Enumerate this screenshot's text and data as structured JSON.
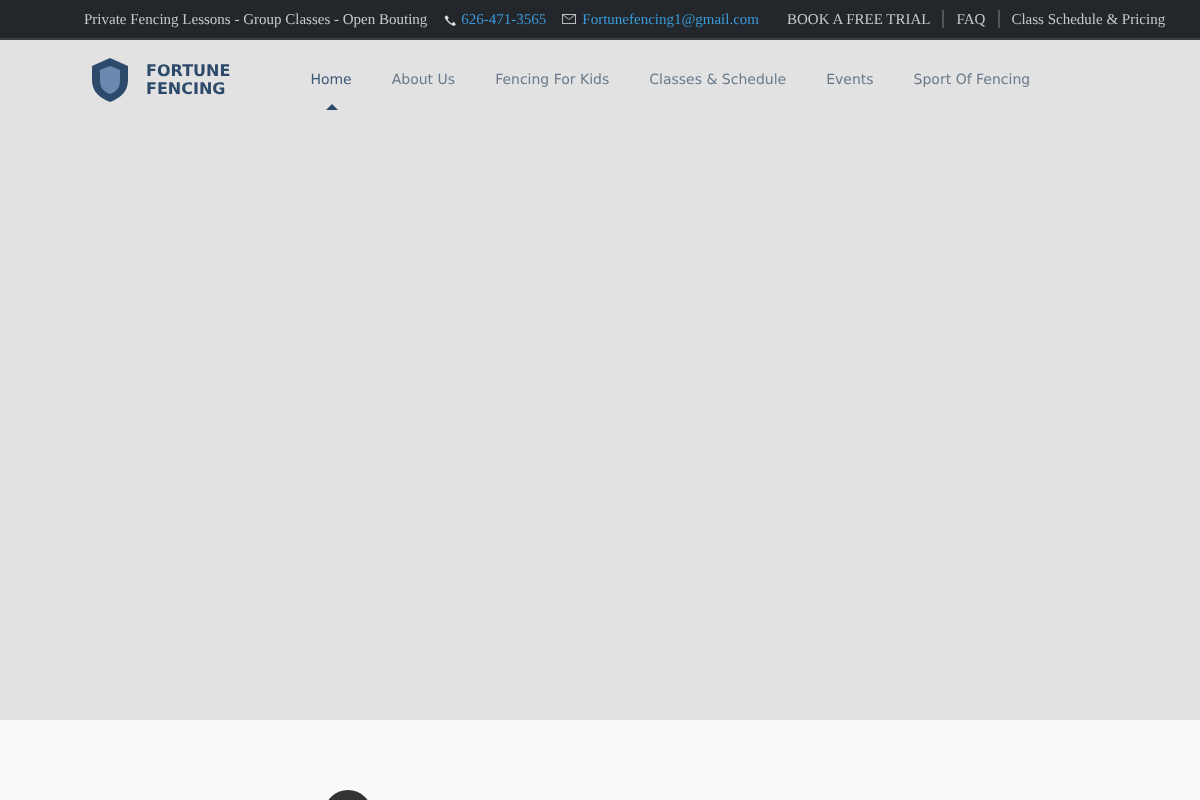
{
  "top_bar": {
    "tagline": "Private Fencing Lessons - Group Classes - Open Bouting",
    "phone": "626-471-3565",
    "email": "Fortunefencing1@gmail.com",
    "links": [
      "BOOK A FREE TRIAL",
      "FAQ",
      "Class Schedule & Pricing"
    ]
  },
  "header": {
    "logo_text": [
      "FORTUNE",
      "FENCING"
    ],
    "nav": [
      {
        "label": "Home",
        "selected": true
      },
      {
        "label": "About Us",
        "selected": false
      },
      {
        "label": "Fencing For Kids",
        "selected": false
      },
      {
        "label": "Classes & Schedule",
        "selected": false
      },
      {
        "label": "Events",
        "selected": false
      },
      {
        "label": "Sport Of Fencing",
        "selected": false
      }
    ]
  }
}
